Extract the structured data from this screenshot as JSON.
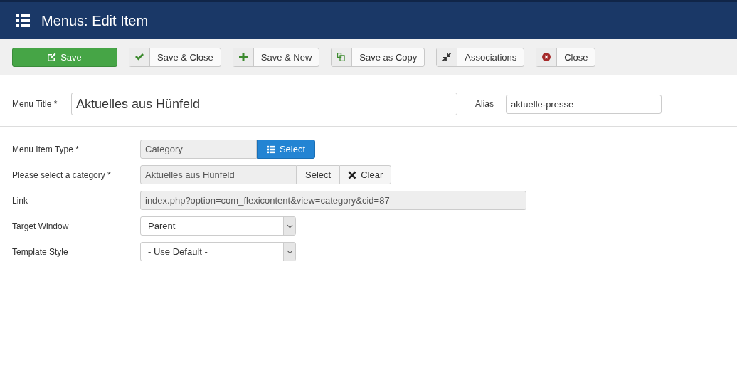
{
  "header": {
    "title": "Menus: Edit Item"
  },
  "toolbar": [
    {
      "label": "Save",
      "kind": "primary"
    },
    {
      "label": "Save & Close",
      "kind": "default"
    },
    {
      "label": "Save & New",
      "kind": "default"
    },
    {
      "label": "Save as Copy",
      "kind": "default"
    },
    {
      "label": "Associations",
      "kind": "default"
    },
    {
      "label": "Close",
      "kind": "default"
    }
  ],
  "title_row": {
    "label": "Menu Title *",
    "value": "Aktuelles aus Hünfeld",
    "alias_label": "Alias",
    "alias_value": "aktuelle-presse"
  },
  "fields": [
    {
      "label": "Menu Item Type *",
      "kind": "type",
      "value": "Category",
      "button": "Select"
    },
    {
      "label": "Please select a category *",
      "kind": "modal",
      "value": "Aktuelles aus Hünfeld",
      "select_button": "Select",
      "clear_button": "Clear"
    },
    {
      "label": "Link",
      "kind": "readonly",
      "value": "index.php?option=com_flexicontent&view=category&cid=87"
    },
    {
      "label": "Target Window",
      "kind": "select",
      "value": "Parent"
    },
    {
      "label": "Template Style",
      "kind": "select",
      "value": "- Use Default -"
    }
  ]
}
